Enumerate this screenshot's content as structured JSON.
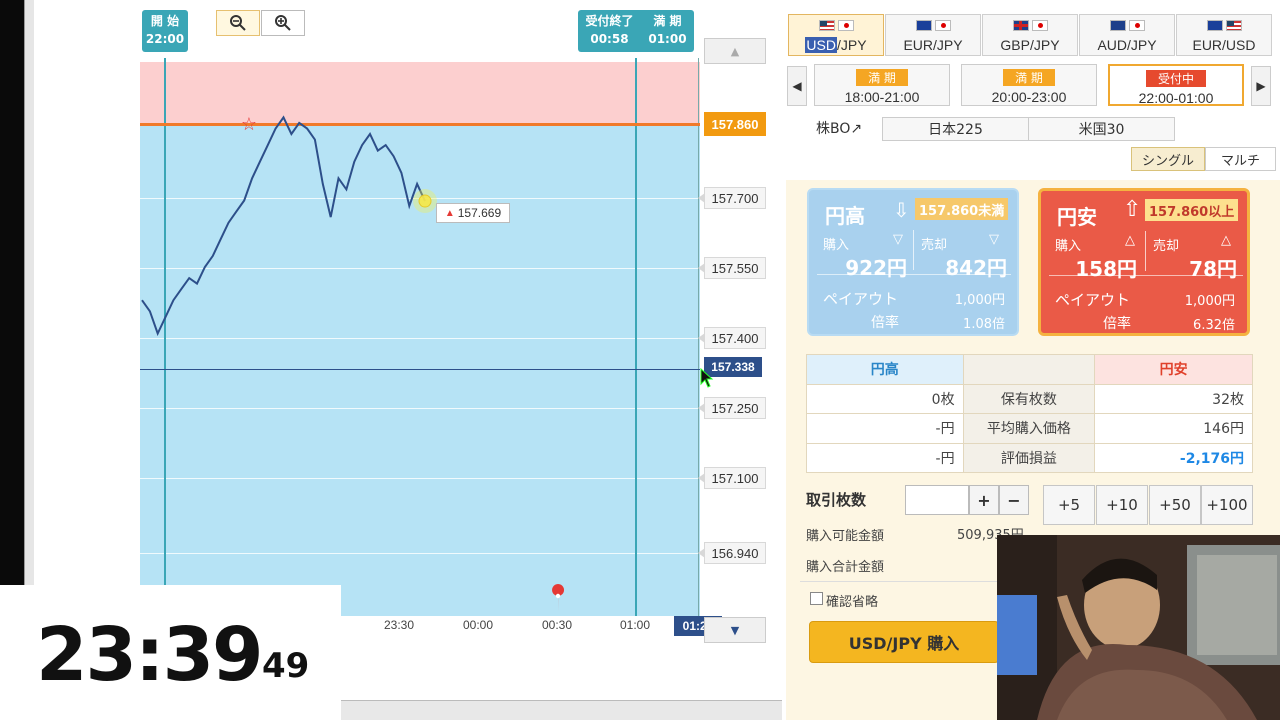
{
  "chart": {
    "start_label": "開 始",
    "start_time": "22:00",
    "close_label": "受付終了",
    "close_time": "00:58",
    "expiry_label": "満 期",
    "expiry_time": "01:00",
    "target_price": "157.860",
    "current_price": "157.338",
    "callout_price": "157.669",
    "y_ticks": [
      "157.700",
      "157.550",
      "157.400",
      "157.250",
      "157.100",
      "156.940"
    ],
    "x_ticks": [
      "23:30",
      "00:00",
      "00:30",
      "01:00"
    ],
    "expiry_marker": "01:24",
    "scroll_up": "▲",
    "scroll_down": "▼",
    "zoom_out_icon": "zoom-out-icon",
    "zoom_in_icon": "zoom-in-icon"
  },
  "chart_data": {
    "type": "line",
    "series": [
      {
        "values": [
          157.49,
          157.47,
          157.43,
          157.46,
          157.49,
          157.51,
          157.53,
          157.52,
          157.55,
          157.57,
          157.6,
          157.63,
          157.65,
          157.67,
          157.71,
          157.74,
          157.77,
          157.8,
          157.82,
          157.79,
          157.81,
          157.8,
          157.78,
          157.7,
          157.64,
          157.71,
          157.69,
          157.74,
          157.77,
          157.79,
          157.76,
          157.77,
          157.75,
          157.72,
          157.66,
          157.7,
          157.669
        ]
      }
    ],
    "ylim": [
      156.92,
      157.92
    ],
    "target": 157.86,
    "current": 157.338
  },
  "clock": {
    "main": "23:39",
    "seconds": "49"
  },
  "pairs": [
    {
      "label_a": "USD",
      "label_b": "/JPY",
      "flags": [
        "us",
        "jp"
      ],
      "active": true
    },
    {
      "label_a": "",
      "label_b": "EUR/JPY",
      "flags": [
        "eu",
        "jp"
      ],
      "active": false
    },
    {
      "label_a": "",
      "label_b": "GBP/JPY",
      "flags": [
        "gb",
        "jp"
      ],
      "active": false
    },
    {
      "label_a": "",
      "label_b": "AUD/JPY",
      "flags": [
        "au",
        "jp"
      ],
      "active": false
    },
    {
      "label_a": "",
      "label_b": "EUR/USD",
      "flags": [
        "eu",
        "us"
      ],
      "active": false
    }
  ],
  "periods": [
    {
      "badge": "満 期",
      "time": "18:00-21:00"
    },
    {
      "badge": "満 期",
      "time": "20:00-23:00"
    },
    {
      "badge": "受付中",
      "time": "22:00-01:00"
    }
  ],
  "stock_bo": "株BO↗",
  "indices": [
    "日本225",
    "米国30"
  ],
  "modes": [
    "シングル",
    "マルチ"
  ],
  "card_high": {
    "title": "円高",
    "condition": "157.860未満",
    "buy_label": "購入",
    "sell_label": "売却",
    "buy_price": "922円",
    "sell_price": "842円",
    "payout_label": "ペイアウト",
    "payout_value": "1,000円",
    "rate_label": "倍率",
    "rate_value": "1.08倍"
  },
  "card_low": {
    "title": "円安",
    "condition": "157.860以上",
    "buy_label": "購入",
    "sell_label": "売却",
    "buy_price": "158円",
    "sell_price": "78円",
    "payout_label": "ペイアウト",
    "payout_value": "1,000円",
    "rate_label": "倍率",
    "rate_value": "6.32倍"
  },
  "positions": {
    "header_high": "円高",
    "header_low": "円安",
    "rows": [
      {
        "high": "0枚",
        "label": "保有枚数",
        "low": "32枚"
      },
      {
        "high": "-円",
        "label": "平均購入価格",
        "low": "146円"
      },
      {
        "high": "-円",
        "label": "評価損益",
        "low": "-2,176円"
      }
    ]
  },
  "order": {
    "qty_label": "取引枚数",
    "qty_value": "",
    "plus": "+",
    "minus": "−",
    "add_buttons": [
      "+5",
      "+10",
      "+50",
      "+100"
    ],
    "available_label": "購入可能金額",
    "available_value": "509,935円",
    "total_label": "購入合計金額",
    "confirm_skip": "確認省略",
    "buy_button": "USD/JPY 購入"
  },
  "colors": {
    "accent_teal": "#3aa6b6",
    "target_orange": "#f29a10",
    "high_blue": "#a9d1ee",
    "low_red": "#ea5a47",
    "buy_yellow": "#f4b620",
    "loss_blue": "#1e88e5"
  }
}
